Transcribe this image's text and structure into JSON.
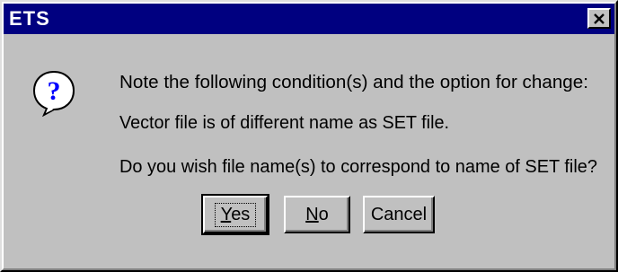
{
  "window": {
    "title": "ETS",
    "close_icon": "close-icon"
  },
  "dialog": {
    "icon": "question-icon",
    "line1": "Note the following condition(s) and the option for change:",
    "line2": "Vector file is of different name as SET file.",
    "line3": "Do you wish file name(s) to correspond to name of SET file?"
  },
  "buttons": {
    "yes": {
      "mnemonic": "Y",
      "rest": "es",
      "label": "Yes"
    },
    "no": {
      "mnemonic": "N",
      "rest": "o",
      "label": "No"
    },
    "cancel": {
      "label": "Cancel"
    }
  },
  "colors": {
    "title_bar": "#000080",
    "face": "#c0c0c0",
    "icon_blue": "#0000ff"
  }
}
